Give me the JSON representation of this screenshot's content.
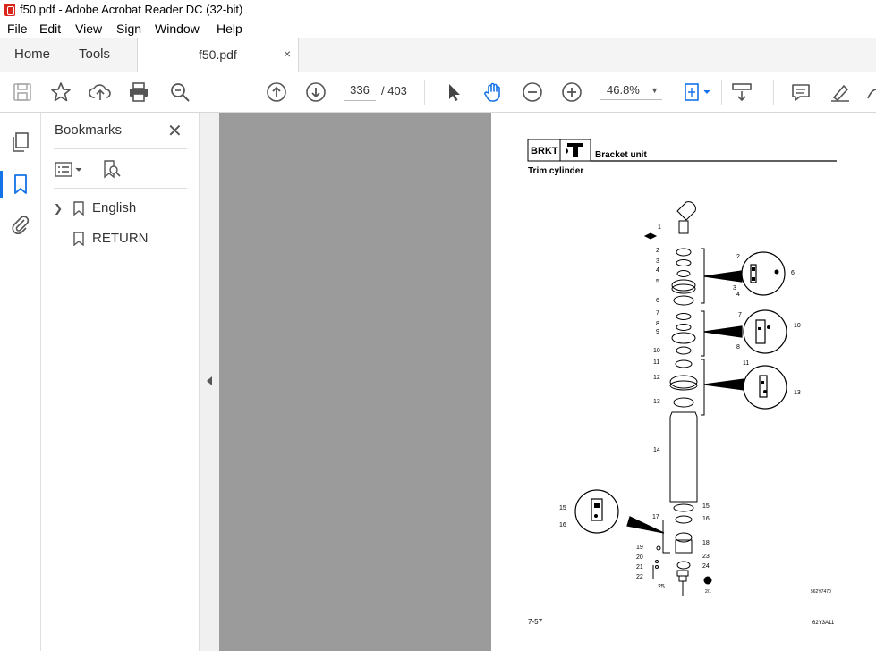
{
  "window": {
    "title": "f50.pdf - Adobe Acrobat Reader DC (32-bit)"
  },
  "menu": [
    "File",
    "Edit",
    "View",
    "Sign",
    "Window",
    "Help"
  ],
  "tabs": {
    "home": "Home",
    "tools": "Tools",
    "document": "f50.pdf",
    "close_glyph": "×"
  },
  "toolbar": {
    "current_page": "336",
    "page_total": "/  403",
    "zoom": "46.8%"
  },
  "sidebar_icons": [
    "pages-icon",
    "bookmark-icon",
    "attachment-icon"
  ],
  "bookmarks": {
    "title": "Bookmarks",
    "close_glyph": "✕",
    "items": [
      {
        "label": "English",
        "expandable": true
      },
      {
        "label": "RETURN",
        "expandable": false
      }
    ]
  },
  "page": {
    "section_code": "BRKT",
    "section_title": "Bracket unit",
    "subtitle": "Trim cylinder",
    "figure_code": "562Y7470",
    "page_number": "7-57",
    "doc_code": "62Y3A11",
    "torque_label": "2/1",
    "callouts_left": [
      "1",
      "2",
      "3",
      "4",
      "5",
      "6",
      "7",
      "8",
      "9",
      "10",
      "11",
      "12",
      "13",
      "14"
    ],
    "callouts_bottom_left": [
      "15",
      "16",
      "17",
      "19",
      "20",
      "21",
      "22",
      "25"
    ],
    "callouts_right": [
      "15",
      "16",
      "18",
      "23",
      "24"
    ],
    "detail1": [
      "2",
      "6",
      "3",
      "4"
    ],
    "detail2": [
      "7",
      "10",
      "8"
    ],
    "detail3": [
      "11",
      "13"
    ],
    "detail4": [
      "15",
      "16"
    ]
  },
  "colors": {
    "accent": "#1473e6",
    "canvas_bg": "#9b9b9b",
    "pdf_red": "#d9261c"
  }
}
